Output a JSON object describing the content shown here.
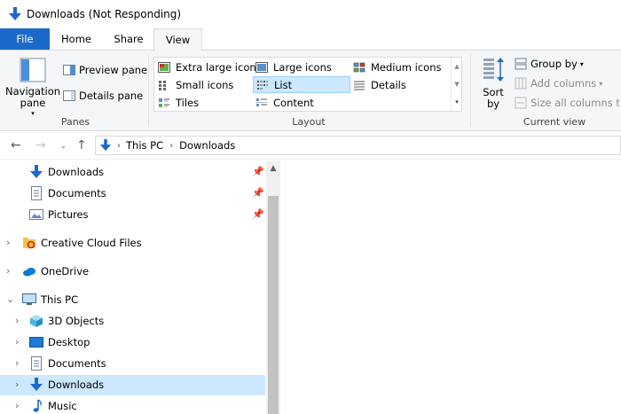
{
  "window": {
    "title": "Downloads (Not Responding)"
  },
  "ribbon_tabs": [
    {
      "label": "File"
    },
    {
      "label": "Home"
    },
    {
      "label": "Share"
    },
    {
      "label": "View"
    }
  ],
  "panes": {
    "navigation_pane": "Navigation pane",
    "preview_pane": "Preview pane",
    "details_pane": "Details pane",
    "group_label": "Panes"
  },
  "layout": {
    "group_label": "Layout",
    "items": [
      {
        "label": "Extra large icons"
      },
      {
        "label": "Large icons"
      },
      {
        "label": "Medium icons"
      },
      {
        "label": "Small icons"
      },
      {
        "label": "List"
      },
      {
        "label": "Details"
      },
      {
        "label": "Tiles"
      },
      {
        "label": "Content"
      }
    ],
    "selected": "List"
  },
  "current_view": {
    "sort_by": "Sort by",
    "group_by": "Group by",
    "add_columns": "Add columns",
    "size_columns": "Size all columns to fit",
    "group_label": "Current view"
  },
  "address": {
    "crumbs": [
      "This PC",
      "Downloads"
    ]
  },
  "nav_tree": [
    {
      "label": "Downloads",
      "icon": "download-arrow-icon",
      "pinned": true
    },
    {
      "label": "Documents",
      "icon": "document-icon",
      "pinned": true
    },
    {
      "label": "Pictures",
      "icon": "pictures-icon",
      "pinned": true
    },
    {
      "label": "Creative Cloud Files",
      "icon": "creative-cloud-icon",
      "pinned": false
    },
    {
      "label": "OneDrive",
      "icon": "onedrive-cloud-icon",
      "pinned": false
    },
    {
      "label": "This PC",
      "icon": "computer-icon",
      "pinned": false
    },
    {
      "label": "3D Objects",
      "icon": "cube-icon",
      "pinned": false
    },
    {
      "label": "Desktop",
      "icon": "desktop-icon",
      "pinned": false
    },
    {
      "label": "Documents",
      "icon": "document-icon",
      "pinned": false
    },
    {
      "label": "Downloads",
      "icon": "download-arrow-icon",
      "pinned": false,
      "selected": true
    },
    {
      "label": "Music",
      "icon": "music-note-icon",
      "pinned": false
    }
  ],
  "colors": {
    "accent": "#1b6ac9",
    "selection": "#cce8ff",
    "ribbon_bg": "#f5f6f7"
  }
}
